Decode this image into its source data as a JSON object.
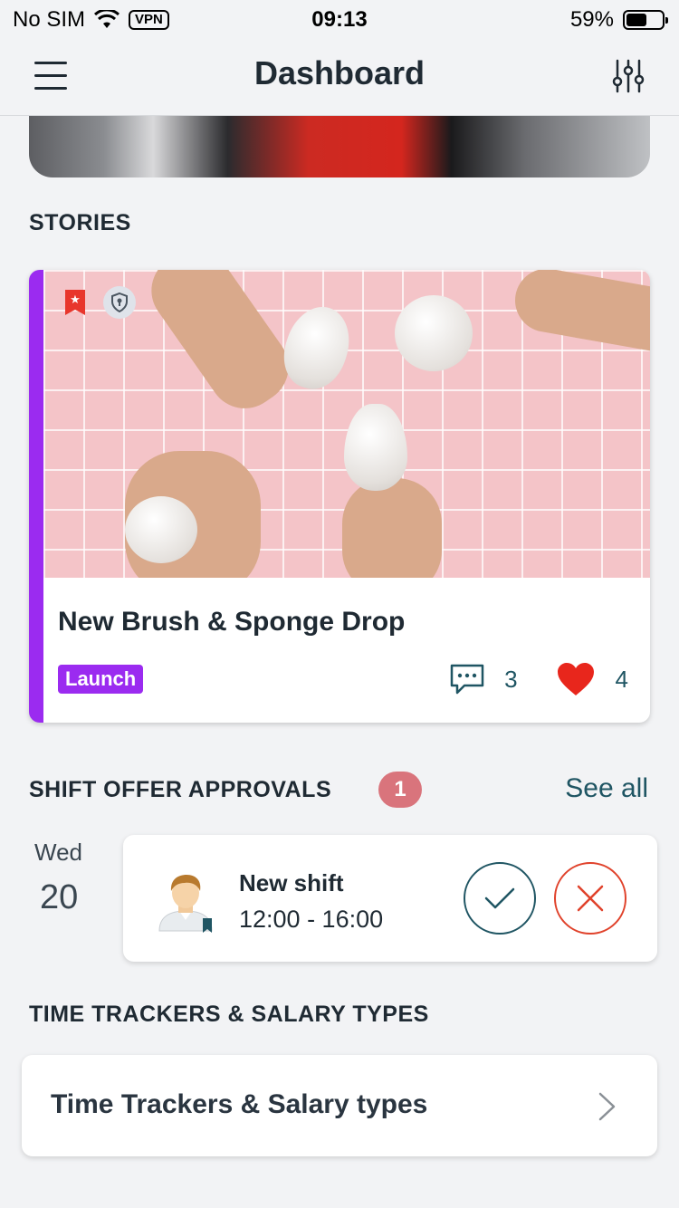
{
  "status_bar": {
    "carrier": "No SIM",
    "vpn": "VPN",
    "time": "09:13",
    "battery": "59%",
    "battery_level": 0.59
  },
  "nav": {
    "title": "Dashboard",
    "menu_icon": "hamburger-icon",
    "filter_icon": "sliders-icon"
  },
  "stories": {
    "section_title": "STORIES",
    "card": {
      "title": "New Brush & Sponge Drop",
      "tag": "Launch",
      "accent_color": "#9b2bf0",
      "comments": "3",
      "likes": "4",
      "badges": [
        "featured-star-bookmark-icon",
        "lock-shield-icon"
      ]
    }
  },
  "shift_offers": {
    "section_title": "SHIFT OFFER APPROVALS",
    "count": "1",
    "see_all": "See all",
    "items": [
      {
        "day_name": "Wed",
        "day_num": "20",
        "title": "New shift",
        "time": "12:00 - 16:00"
      }
    ]
  },
  "time_trackers": {
    "section_title": "TIME TRACKERS & SALARY TYPES",
    "item_label": "Time Trackers & Salary types"
  },
  "colors": {
    "primary_teal": "#1f5563",
    "accent_purple": "#9b2bf0",
    "reject_red": "#e0422b",
    "heart_red": "#e8261c",
    "badge_pink": "#d9747c",
    "background": "#f2f3f5"
  }
}
